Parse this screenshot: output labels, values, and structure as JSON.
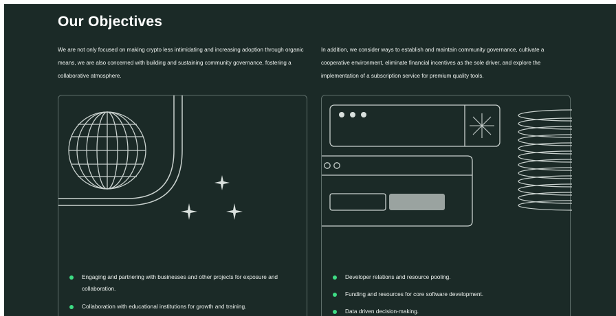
{
  "section": {
    "title": "Our Objectives",
    "intro_left": "We are not only focused on making crypto less intimidating and increasing adoption through organic means, we are also concerned with building and sustaining community governance, fostering a collaborative atmosphere.",
    "intro_right": "In addition, we consider ways to establish and maintain community governance, cultivate a cooperative environment, eliminate financial incentives as the sole driver, and explore the implementation of a subscription service for premium quality tools."
  },
  "cards": {
    "left": {
      "illustration": "globe-icon",
      "bullets": [
        "Engaging and partnering with businesses and other projects for exposure and collaboration.",
        "Collaboration with educational institutions for growth and training."
      ]
    },
    "right": {
      "illustration": "browser-windows-icon",
      "bullets": [
        "Developer relations and resource pooling.",
        "Funding and resources for core software development.",
        "Data driven decision-making."
      ]
    }
  },
  "colors": {
    "background": "#1b2a27",
    "line": "#c9d1ce",
    "accent": "#3ddc84",
    "button_fill": "#9aa3a0"
  }
}
